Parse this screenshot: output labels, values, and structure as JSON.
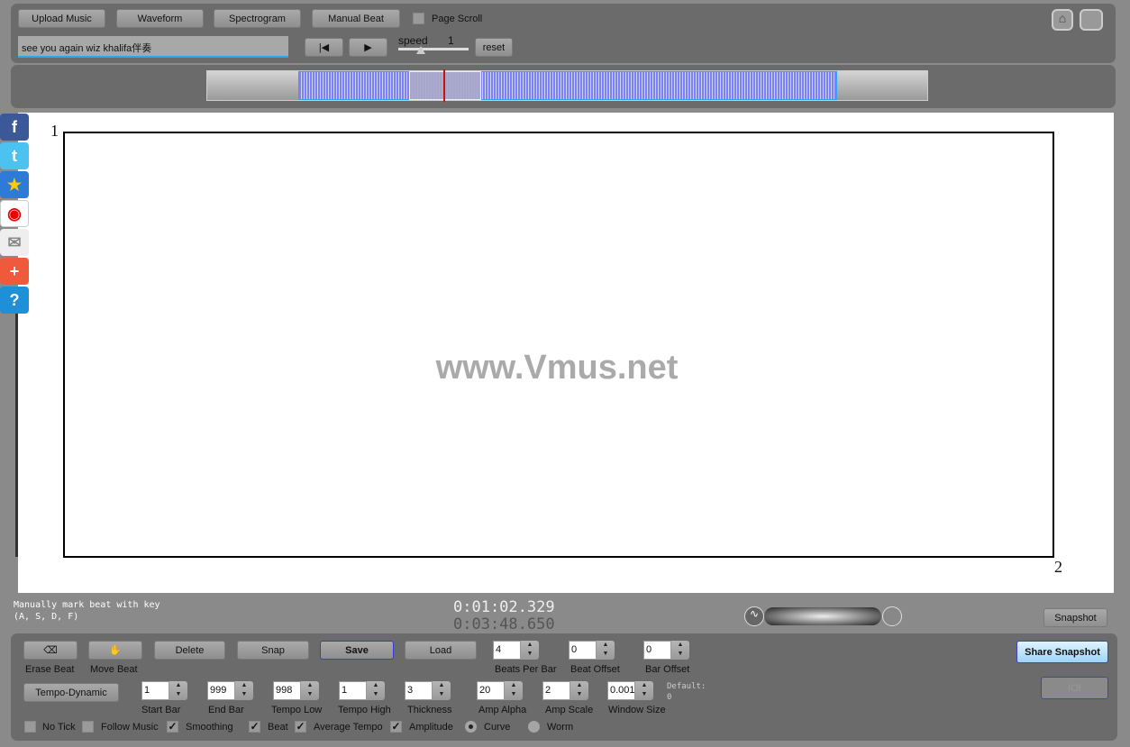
{
  "toolbar": {
    "upload": "Upload Music",
    "waveform": "Waveform",
    "spectrogram": "Spectrogram",
    "manual_beat": "Manual Beat",
    "page_scroll": "Page Scroll",
    "song_title": "see you again wiz khalifa伴奏",
    "speed_label": "speed",
    "speed_value": "1",
    "reset": "reset"
  },
  "canvas": {
    "watermark": "www.Vmus.net",
    "bar_start": "1",
    "bar_end": "2"
  },
  "status": {
    "hint_line1": "Manually mark beat with key",
    "hint_line2": "(A, S, D, F)",
    "current_time": "0:01:02.329",
    "total_time": "0:03:48.650",
    "snapshot": "Snapshot"
  },
  "social": [
    "facebook",
    "twitter",
    "favorite",
    "weibo",
    "email",
    "add",
    "help"
  ],
  "controls": {
    "erase_beat": "Erase Beat",
    "move_beat": "Move Beat",
    "delete": "Delete",
    "snap": "Snap",
    "save": "Save",
    "load": "Load",
    "tempo_dynamic": "Tempo-Dynamic",
    "share_snapshot": "Share Snapshot",
    "ioi": "IOI",
    "row1": [
      {
        "label": "Beats Per Bar",
        "value": "4"
      },
      {
        "label": "Beat Offset",
        "value": "0"
      },
      {
        "label": "Bar Offset",
        "value": "0"
      }
    ],
    "row2": [
      {
        "label": "Start Bar",
        "value": "1"
      },
      {
        "label": "End Bar",
        "value": "999"
      },
      {
        "label": "Tempo Low",
        "value": "998"
      },
      {
        "label": "Tempo High",
        "value": "1"
      },
      {
        "label": "Thickness",
        "value": "3"
      },
      {
        "label": "Amp Alpha",
        "value": "20"
      },
      {
        "label": "Amp Scale",
        "value": "2"
      },
      {
        "label": "Window Size",
        "value": "0.001"
      }
    ],
    "default_label": "Default:",
    "default_value": "0",
    "checks": [
      {
        "label": "No Tick",
        "checked": false
      },
      {
        "label": "Follow Music",
        "checked": false
      },
      {
        "label": "Smoothing",
        "checked": true
      },
      {
        "label": "Beat",
        "checked": true
      },
      {
        "label": "Average Tempo",
        "checked": true
      },
      {
        "label": "Amplitude",
        "checked": true
      }
    ],
    "radios": [
      {
        "label": "Curve",
        "selected": true
      },
      {
        "label": "Worm",
        "selected": false
      }
    ],
    "check_mark": "✓"
  },
  "colors": {
    "accent": "#2aa9f0",
    "waveform": "#8080f0",
    "playhead": "#d01010"
  }
}
